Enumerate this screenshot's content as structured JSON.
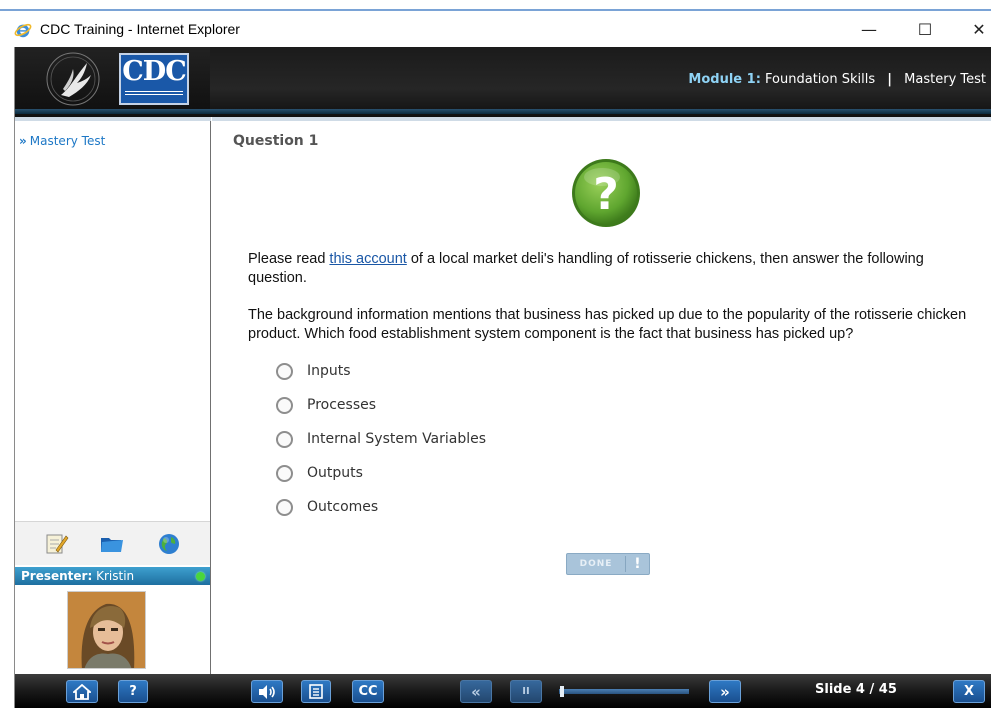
{
  "window": {
    "title": "CDC Training - Internet Explorer"
  },
  "header": {
    "cdc_logo_text": "CDC",
    "module_prefix": "Module 1:",
    "module_name": "Foundation Skills",
    "separator": "|",
    "section": "Mastery Test"
  },
  "sidebar": {
    "menu_arrow": "»",
    "menu_item": "Mastery Test",
    "presenter_label": "Presenter:",
    "presenter_name": "Kristin",
    "tools": [
      "notepad-icon",
      "folder-icon",
      "globe-icon"
    ]
  },
  "question": {
    "title": "Question 1",
    "badge": "?",
    "para1_before": "Please read ",
    "para1_link": "this account",
    "para1_after": " of a local market deli's handling of rotisserie chickens, then answer the following question.",
    "para2": "The background information mentions that business has picked up due to the popularity of the rotisserie chicken product.  Which food establishment system component is the fact that business has picked up?",
    "options": [
      "Inputs",
      "Processes",
      "Internal System Variables",
      "Outputs",
      "Outcomes"
    ],
    "done_label": "DONE",
    "done_alert": "!"
  },
  "controls": {
    "help": "?",
    "cc": "CC",
    "prev": "«",
    "pause": "II",
    "next": "»",
    "close": "X",
    "slide_counter": "Slide 4 / 45",
    "progress": 0.02
  },
  "colors": {
    "accent": "#1e78c6",
    "header_bg": "#1b1b1b",
    "badge_green": "#6db33f"
  }
}
